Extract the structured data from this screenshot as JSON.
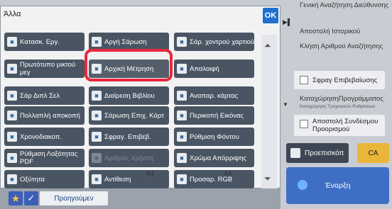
{
  "popup": {
    "title": "Άλλα",
    "ok_label": "OK",
    "buttons": [
      {
        "label": "Κατασκ. Εργ.",
        "icon": "build-job-icon",
        "disabled": false
      },
      {
        "label": "Αργή Σάρωση",
        "icon": "slow-scan-icon",
        "disabled": false
      },
      {
        "label": "Σάρ. χοντρού χαρτιού",
        "icon": "thick-paper-icon",
        "disabled": false
      },
      {
        "label": "Πρωτότυπο μικτού μεγ",
        "icon": "mixed-original-icon",
        "disabled": false
      },
      {
        "label": "Αρχική Μέτρηση",
        "icon": "original-count-icon",
        "disabled": false,
        "highlighted": true
      },
      {
        "label": "Απαλοιφή",
        "icon": "erase-icon",
        "disabled": false
      },
      {
        "label": "Σάρ Διπλ Σελ",
        "icon": "dual-page-icon",
        "disabled": false
      },
      {
        "label": "Διαίρεση Βιβλίου",
        "icon": "book-divide-icon",
        "disabled": false
      },
      {
        "label": "Αναπαρ. κάρτας",
        "icon": "card-shot-icon",
        "disabled": false
      },
      {
        "label": "Πολλαπλή αποκοπή",
        "icon": "multi-crop-icon",
        "disabled": false
      },
      {
        "label": "Σάρωση Επιχ. Κάρτ",
        "icon": "business-card-icon",
        "disabled": false
      },
      {
        "label": "Περικοπή Εικόνας",
        "icon": "image-crop-icon",
        "disabled": false
      },
      {
        "label": "Χρονοδιακοπ.",
        "icon": "timer-icon",
        "disabled": false
      },
      {
        "label": "Σφραγ. Επιβεβ.",
        "icon": "verify-stamp-icon",
        "disabled": false
      },
      {
        "label": "Ρύθμιση Φόντου",
        "icon": "background-icon",
        "disabled": false
      },
      {
        "label": "Ρύθμιση Λοξότητας PDF",
        "icon": "pdf-skew-icon",
        "disabled": false
      },
      {
        "label": "Αριθμός Χρήστη",
        "icon": "user-number-icon",
        "disabled": true
      },
      {
        "label": "Χρώμα Απόρριψης",
        "icon": "color-drop-icon",
        "disabled": false
      },
      {
        "label": "Οξύτητα",
        "icon": "sharpness-icon",
        "disabled": false
      },
      {
        "label": "Αντίθεση",
        "icon": "contrast-icon",
        "disabled": false
      },
      {
        "label": "Προσαρ. RGB",
        "icon": "rgb-adjust-icon",
        "disabled": false
      }
    ],
    "paper_left": "A4",
    "paper_right": "A4"
  },
  "bottom_bar": {
    "previous_label": "Προηγούμεν"
  },
  "right_panel": {
    "general_search": "Γενική Αναζήτηση Διεύθυνσης",
    "send_history": "Αποστολή Ιστορικού",
    "call_number_search": "Κλήση Αριθμού Αναζήτησης",
    "verify_stamp": "Σφραγ Επιβεβαίωσης",
    "register_program": "ΚαταχώρησηΠρογράμματος",
    "register_current_settings": "Καταχώρηση Τρεχουσών Ρυθμίσεων",
    "send_link": "Αποστολή Συνδέσμου Προορισμού",
    "preview_label": "Προεπισκόπ",
    "ca_label": "CA",
    "start_label": "Έναρξη"
  },
  "colors": {
    "accent": "#1e6fd0",
    "highlight_ring": "#e8293d",
    "start_button": "#3f6fc4",
    "ca_button": "#e9b63a"
  }
}
